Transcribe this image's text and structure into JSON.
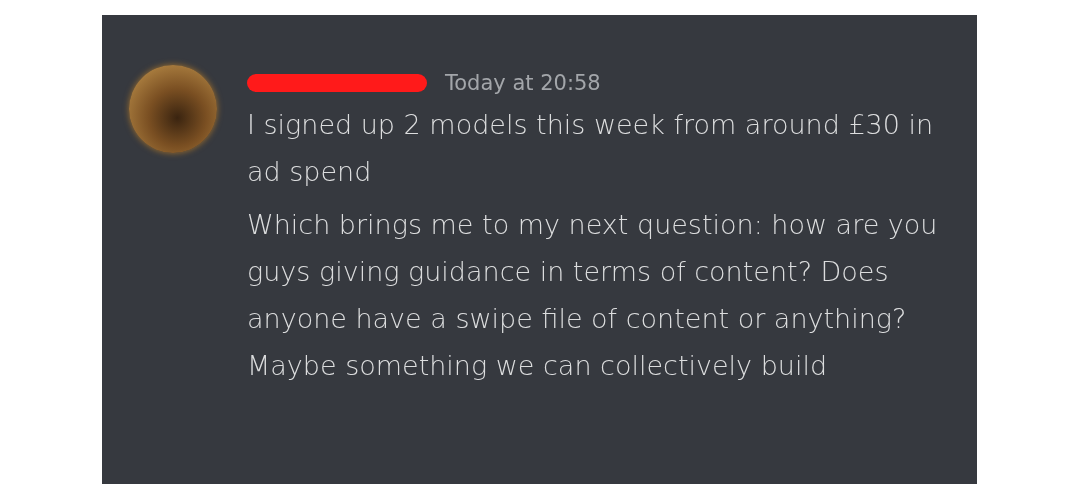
{
  "message": {
    "author": {
      "redacted": true
    },
    "timestamp": "Today at 20:58",
    "paragraphs": [
      "I signed up 2 models this week from around £30 in ad spend",
      "Which brings me to my next question: how are you guys giving guidance in terms of content? Does anyone have a swipe file of content or anything? Maybe something we can collectively build"
    ]
  }
}
